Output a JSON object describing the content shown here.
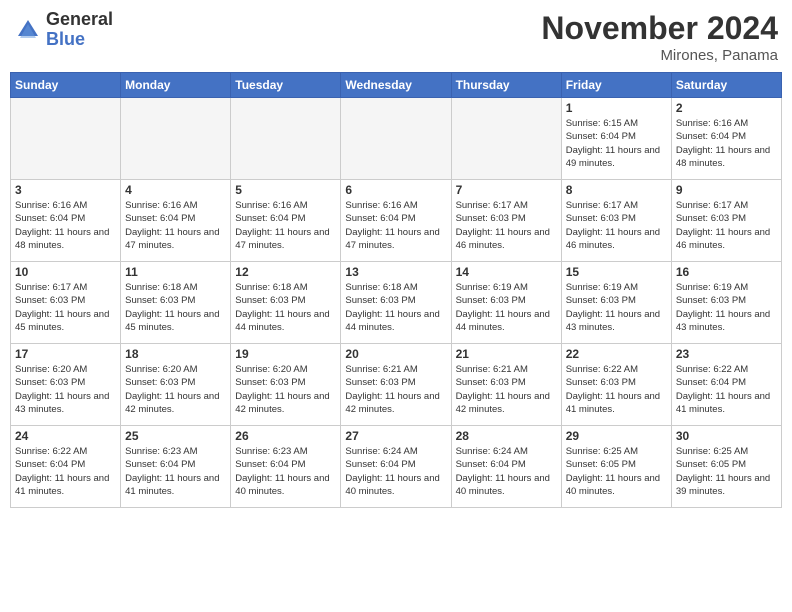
{
  "logo": {
    "general": "General",
    "blue": "Blue"
  },
  "title": "November 2024",
  "location": "Mirones, Panama",
  "weekdays": [
    "Sunday",
    "Monday",
    "Tuesday",
    "Wednesday",
    "Thursday",
    "Friday",
    "Saturday"
  ],
  "weeks": [
    [
      {
        "day": "",
        "empty": true
      },
      {
        "day": "",
        "empty": true
      },
      {
        "day": "",
        "empty": true
      },
      {
        "day": "",
        "empty": true
      },
      {
        "day": "",
        "empty": true
      },
      {
        "day": "1",
        "sunrise": "Sunrise: 6:15 AM",
        "sunset": "Sunset: 6:04 PM",
        "daylight": "Daylight: 11 hours and 49 minutes."
      },
      {
        "day": "2",
        "sunrise": "Sunrise: 6:16 AM",
        "sunset": "Sunset: 6:04 PM",
        "daylight": "Daylight: 11 hours and 48 minutes."
      }
    ],
    [
      {
        "day": "3",
        "sunrise": "Sunrise: 6:16 AM",
        "sunset": "Sunset: 6:04 PM",
        "daylight": "Daylight: 11 hours and 48 minutes."
      },
      {
        "day": "4",
        "sunrise": "Sunrise: 6:16 AM",
        "sunset": "Sunset: 6:04 PM",
        "daylight": "Daylight: 11 hours and 47 minutes."
      },
      {
        "day": "5",
        "sunrise": "Sunrise: 6:16 AM",
        "sunset": "Sunset: 6:04 PM",
        "daylight": "Daylight: 11 hours and 47 minutes."
      },
      {
        "day": "6",
        "sunrise": "Sunrise: 6:16 AM",
        "sunset": "Sunset: 6:04 PM",
        "daylight": "Daylight: 11 hours and 47 minutes."
      },
      {
        "day": "7",
        "sunrise": "Sunrise: 6:17 AM",
        "sunset": "Sunset: 6:03 PM",
        "daylight": "Daylight: 11 hours and 46 minutes."
      },
      {
        "day": "8",
        "sunrise": "Sunrise: 6:17 AM",
        "sunset": "Sunset: 6:03 PM",
        "daylight": "Daylight: 11 hours and 46 minutes."
      },
      {
        "day": "9",
        "sunrise": "Sunrise: 6:17 AM",
        "sunset": "Sunset: 6:03 PM",
        "daylight": "Daylight: 11 hours and 46 minutes."
      }
    ],
    [
      {
        "day": "10",
        "sunrise": "Sunrise: 6:17 AM",
        "sunset": "Sunset: 6:03 PM",
        "daylight": "Daylight: 11 hours and 45 minutes."
      },
      {
        "day": "11",
        "sunrise": "Sunrise: 6:18 AM",
        "sunset": "Sunset: 6:03 PM",
        "daylight": "Daylight: 11 hours and 45 minutes."
      },
      {
        "day": "12",
        "sunrise": "Sunrise: 6:18 AM",
        "sunset": "Sunset: 6:03 PM",
        "daylight": "Daylight: 11 hours and 44 minutes."
      },
      {
        "day": "13",
        "sunrise": "Sunrise: 6:18 AM",
        "sunset": "Sunset: 6:03 PM",
        "daylight": "Daylight: 11 hours and 44 minutes."
      },
      {
        "day": "14",
        "sunrise": "Sunrise: 6:19 AM",
        "sunset": "Sunset: 6:03 PM",
        "daylight": "Daylight: 11 hours and 44 minutes."
      },
      {
        "day": "15",
        "sunrise": "Sunrise: 6:19 AM",
        "sunset": "Sunset: 6:03 PM",
        "daylight": "Daylight: 11 hours and 43 minutes."
      },
      {
        "day": "16",
        "sunrise": "Sunrise: 6:19 AM",
        "sunset": "Sunset: 6:03 PM",
        "daylight": "Daylight: 11 hours and 43 minutes."
      }
    ],
    [
      {
        "day": "17",
        "sunrise": "Sunrise: 6:20 AM",
        "sunset": "Sunset: 6:03 PM",
        "daylight": "Daylight: 11 hours and 43 minutes."
      },
      {
        "day": "18",
        "sunrise": "Sunrise: 6:20 AM",
        "sunset": "Sunset: 6:03 PM",
        "daylight": "Daylight: 11 hours and 42 minutes."
      },
      {
        "day": "19",
        "sunrise": "Sunrise: 6:20 AM",
        "sunset": "Sunset: 6:03 PM",
        "daylight": "Daylight: 11 hours and 42 minutes."
      },
      {
        "day": "20",
        "sunrise": "Sunrise: 6:21 AM",
        "sunset": "Sunset: 6:03 PM",
        "daylight": "Daylight: 11 hours and 42 minutes."
      },
      {
        "day": "21",
        "sunrise": "Sunrise: 6:21 AM",
        "sunset": "Sunset: 6:03 PM",
        "daylight": "Daylight: 11 hours and 42 minutes."
      },
      {
        "day": "22",
        "sunrise": "Sunrise: 6:22 AM",
        "sunset": "Sunset: 6:03 PM",
        "daylight": "Daylight: 11 hours and 41 minutes."
      },
      {
        "day": "23",
        "sunrise": "Sunrise: 6:22 AM",
        "sunset": "Sunset: 6:04 PM",
        "daylight": "Daylight: 11 hours and 41 minutes."
      }
    ],
    [
      {
        "day": "24",
        "sunrise": "Sunrise: 6:22 AM",
        "sunset": "Sunset: 6:04 PM",
        "daylight": "Daylight: 11 hours and 41 minutes."
      },
      {
        "day": "25",
        "sunrise": "Sunrise: 6:23 AM",
        "sunset": "Sunset: 6:04 PM",
        "daylight": "Daylight: 11 hours and 41 minutes."
      },
      {
        "day": "26",
        "sunrise": "Sunrise: 6:23 AM",
        "sunset": "Sunset: 6:04 PM",
        "daylight": "Daylight: 11 hours and 40 minutes."
      },
      {
        "day": "27",
        "sunrise": "Sunrise: 6:24 AM",
        "sunset": "Sunset: 6:04 PM",
        "daylight": "Daylight: 11 hours and 40 minutes."
      },
      {
        "day": "28",
        "sunrise": "Sunrise: 6:24 AM",
        "sunset": "Sunset: 6:04 PM",
        "daylight": "Daylight: 11 hours and 40 minutes."
      },
      {
        "day": "29",
        "sunrise": "Sunrise: 6:25 AM",
        "sunset": "Sunset: 6:05 PM",
        "daylight": "Daylight: 11 hours and 40 minutes."
      },
      {
        "day": "30",
        "sunrise": "Sunrise: 6:25 AM",
        "sunset": "Sunset: 6:05 PM",
        "daylight": "Daylight: 11 hours and 39 minutes."
      }
    ]
  ]
}
